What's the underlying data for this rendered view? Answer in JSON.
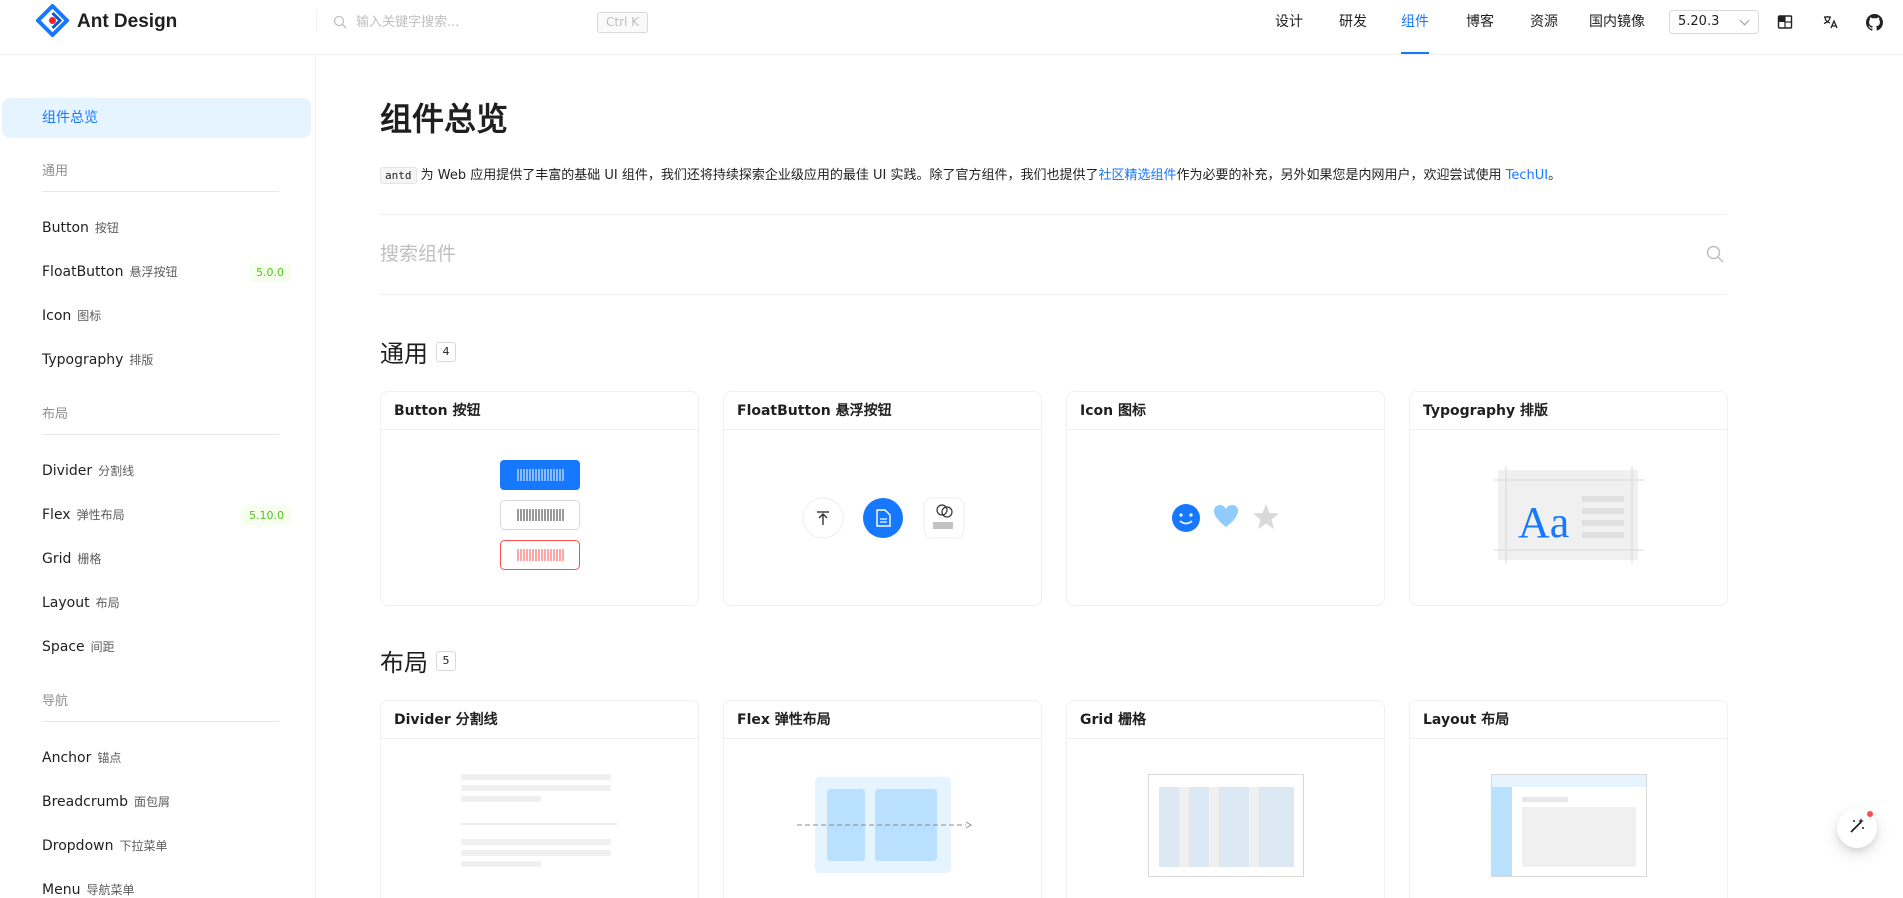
{
  "header": {
    "logo_text": "Ant Design",
    "search_placeholder": "输入关键字搜索...",
    "search_shortcut": "Ctrl K",
    "nav": [
      {
        "label": "设计",
        "active": false
      },
      {
        "label": "研发",
        "active": false
      },
      {
        "label": "组件",
        "active": true
      },
      {
        "label": "博客",
        "active": false
      },
      {
        "label": "资源",
        "active": false
      },
      {
        "label": "国内镜像",
        "active": false
      }
    ],
    "version": "5.20.3",
    "icons": [
      "theme-icon",
      "language-icon",
      "github-icon"
    ]
  },
  "sidebar": {
    "active_item": "组件总览",
    "groups": [
      {
        "title": "通用",
        "items": [
          {
            "label": "Button",
            "sub": "按钮"
          },
          {
            "label": "FloatButton",
            "sub": "悬浮按钮",
            "tag": "5.0.0"
          },
          {
            "label": "Icon",
            "sub": "图标"
          },
          {
            "label": "Typography",
            "sub": "排版"
          }
        ]
      },
      {
        "title": "布局",
        "items": [
          {
            "label": "Divider",
            "sub": "分割线"
          },
          {
            "label": "Flex",
            "sub": "弹性布局",
            "tag": "5.10.0"
          },
          {
            "label": "Grid",
            "sub": "栅格"
          },
          {
            "label": "Layout",
            "sub": "布局"
          },
          {
            "label": "Space",
            "sub": "间距"
          }
        ]
      },
      {
        "title": "导航",
        "items": [
          {
            "label": "Anchor",
            "sub": "锚点"
          },
          {
            "label": "Breadcrumb",
            "sub": "面包屑"
          },
          {
            "label": "Dropdown",
            "sub": "下拉菜单"
          },
          {
            "label": "Menu",
            "sub": "导航菜单"
          }
        ]
      }
    ]
  },
  "main": {
    "title": "组件总览",
    "intro": {
      "code": "antd",
      "text1": " 为 Web 应用提供了丰富的基础 UI 组件，我们还将持续探索企业级应用的最佳 UI 实践。除了官方组件，我们也提供了",
      "link1": "社区精选组件",
      "text2": "作为必要的补充，另外如果您是内网用户，欢迎尝试使用 ",
      "link2": "TechUI",
      "text3": "。"
    },
    "search_placeholder": "搜索组件",
    "sections": [
      {
        "title": "通用",
        "count": "4",
        "cards": [
          "Button 按钮",
          "FloatButton 悬浮按钮",
          "Icon 图标",
          "Typography 排版"
        ]
      },
      {
        "title": "布局",
        "count": "5",
        "cards": [
          "Divider 分割线",
          "Flex 弹性布局",
          "Grid 栅格",
          "Layout 布局"
        ]
      }
    ]
  },
  "colors": {
    "primary": "#1677ff",
    "primary_bg": "#e6f4ff",
    "tag_green": "#52c41a",
    "danger": "#ff4d4f"
  }
}
